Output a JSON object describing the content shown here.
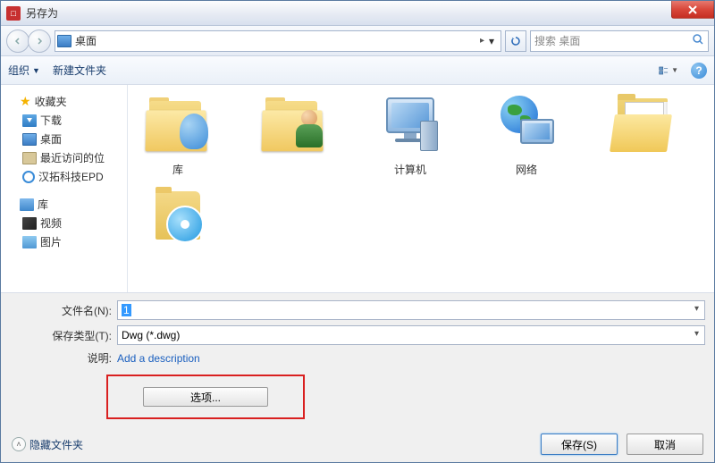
{
  "titlebar": {
    "title": "另存为"
  },
  "navbar": {
    "location_icon": "desktop-icon",
    "location": "桌面",
    "breadcrumb_sep": "▸",
    "search_placeholder": "搜索 桌面"
  },
  "toolbar": {
    "organize": "组织",
    "new_folder": "新建文件夹"
  },
  "sidebar": {
    "favorites": {
      "label": "收藏夹",
      "items": [
        {
          "label": "下载",
          "icon": "download"
        },
        {
          "label": "桌面",
          "icon": "desktop"
        },
        {
          "label": "最近访问的位",
          "icon": "recent"
        },
        {
          "label": "汉拓科技EPD",
          "icon": "epd"
        }
      ]
    },
    "libraries": {
      "label": "库",
      "items": [
        {
          "label": "视频",
          "icon": "video"
        },
        {
          "label": "图片",
          "icon": "image"
        }
      ]
    }
  },
  "files": [
    {
      "label": "库",
      "kind": "library-folder"
    },
    {
      "label": "",
      "kind": "user-folder"
    },
    {
      "label": "计算机",
      "kind": "computer"
    },
    {
      "label": "网络",
      "kind": "network"
    },
    {
      "label": "",
      "kind": "open-folder"
    },
    {
      "label": "",
      "kind": "cd-folder"
    }
  ],
  "form": {
    "filename_label": "文件名(N):",
    "filename_value": "1",
    "savetype_label": "保存类型(T):",
    "savetype_value": "Dwg (*.dwg)",
    "desc_label": "说明:",
    "desc_link": "Add a description",
    "options_button": "选项..."
  },
  "footer": {
    "hide_folders": "隐藏文件夹",
    "save": "保存(S)",
    "cancel": "取消"
  }
}
